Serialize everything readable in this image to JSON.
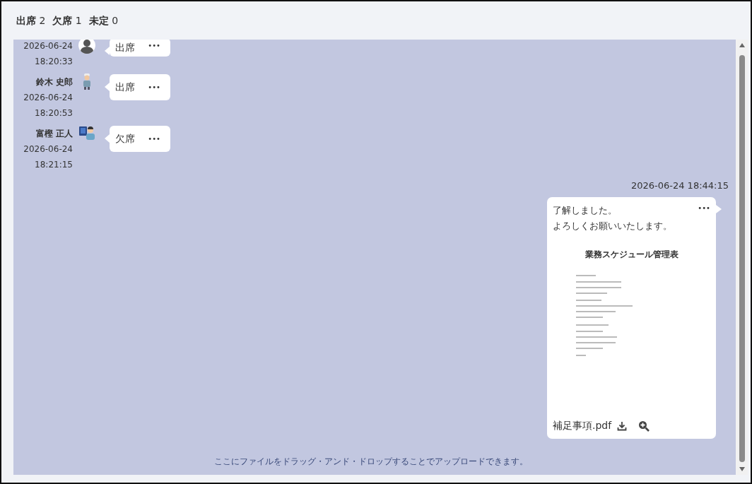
{
  "summary": [
    {
      "label": "出席",
      "count": "2"
    },
    {
      "label": "欠席",
      "count": "1"
    },
    {
      "label": "未定",
      "count": "0"
    }
  ],
  "replies": [
    {
      "date": "2026-06-24",
      "time": "18:20:33",
      "answer": "出席",
      "menu": "•••"
    },
    {
      "name": "鈴木 史郎",
      "date": "2026-06-24",
      "time": "18:20:53",
      "answer": "出席",
      "menu": "•••"
    },
    {
      "name": "富樫 正人",
      "date": "2026-06-24",
      "time": "18:21:15",
      "answer": "欠席",
      "menu": "•••"
    }
  ],
  "own_message": {
    "timestamp": "2026-06-24 18:44:15",
    "lines": [
      "了解しました。",
      "よろしくお願いいたします。"
    ],
    "menu": "•••",
    "attachment": {
      "preview_title": "業務スケジュール管理表",
      "file_name": "補足事項.pdf"
    }
  },
  "drop_hint": "ここにファイルをドラッグ・アンド・ドロップすることでアップロードできます。"
}
